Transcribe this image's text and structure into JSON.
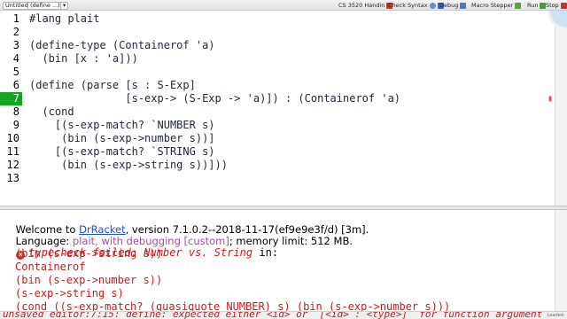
{
  "toolbar": {
    "file_dropdown": "Untitled 2 ▾",
    "define_dropdown": "(define ...) ▾",
    "arrow_dropdown": "▾",
    "handin_label": "CS 3520 Handin",
    "check_syntax_label": "Check Syntax",
    "debug_label": "Debug",
    "macro_stepper_label": "Macro Stepper",
    "run_label": "Run",
    "stop_label": "Stop"
  },
  "editor": {
    "active_line": 7,
    "lines": [
      {
        "num": "1",
        "text": "#lang plait"
      },
      {
        "num": "2",
        "text": ""
      },
      {
        "num": "3",
        "text": "(define-type (Containerof 'a)"
      },
      {
        "num": "4",
        "text": "  (bin [x : 'a]))"
      },
      {
        "num": "5",
        "text": ""
      },
      {
        "num": "6",
        "text": "(define (parse [s : S-Exp]"
      },
      {
        "num": "7",
        "text": "               [s-exp-> (S-Exp -> 'a)]) : (Containerof 'a)"
      },
      {
        "num": "8",
        "text": "  (cond"
      },
      {
        "num": "9",
        "text": "    [(s-exp-match? `NUMBER s)"
      },
      {
        "num": "10",
        "text": "     (bin (s-exp->number s))]"
      },
      {
        "num": "11",
        "text": "    [(s-exp-match? `STRING s)"
      },
      {
        "num": "12",
        "text": "     (bin (s-exp->string s))]))"
      },
      {
        "num": "13",
        "text": ""
      }
    ]
  },
  "interactions": {
    "welcome_prefix": "Welcome to ",
    "welcome_link": "DrRacket",
    "welcome_suffix": ", version 7.1.0.2--2018-11-17(ef9e9e3f/d) [3m].",
    "language_prefix": "Language: ",
    "language_value": "plait, with debugging [custom]",
    "language_suffix": "; memory limit: 512 MB.",
    "error_message": "typecheck failed: Number vs. String",
    "error_in": " in:",
    "error_lines": [
      "(bin (s-exp->string s))",
      "Containerof",
      "(bin (s-exp->number s))",
      "(s-exp->string s)",
      "(cond ((s-exp-match? (quasiquote NUMBER) s) (bin (s-exp->number s)))"
    ]
  },
  "status": {
    "message": "unsaved editor:7:15: define: expected either <id> or `[<id> : <type>]` for function argument",
    "right_text": "Loaded"
  },
  "colors": {
    "active_line_bg": "#13a51c",
    "error_red": "#c11f1f",
    "link_blue": "#1a4fd6",
    "language_purple": "#a04fb2"
  }
}
